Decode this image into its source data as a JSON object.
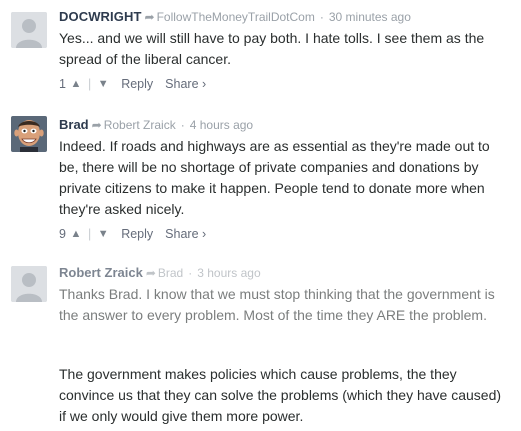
{
  "comments": [
    {
      "author": "DOCWRIGHT",
      "reply_to": "FollowTheMoneyTrailDotCom",
      "time": "30 minutes ago",
      "paragraphs": [
        "Yes... and we will still have to pay both. I hate tolls. I see them as the spread of the liberal cancer."
      ],
      "votes": "1",
      "reply_label": "Reply",
      "share_label": "Share ›",
      "avatar": "default-avatar"
    },
    {
      "author": "Brad",
      "reply_to": "Robert Zraick",
      "time": "4 hours ago",
      "paragraphs": [
        "Indeed. If roads and highways are as essential as they're made out to be, there will be no shortage of private companies and donations by private citizens to make it happen. People tend to donate more when they're asked nicely."
      ],
      "votes": "9",
      "reply_label": "Reply",
      "share_label": "Share ›",
      "avatar": "caricature-photo"
    },
    {
      "author": "Robert Zraick",
      "reply_to": "Brad",
      "time": "3 hours ago",
      "paragraphs": [
        "Thanks Brad. I know that we must stop thinking that the government is the answer to every problem. Most of the time they ARE the problem.",
        "The government makes policies which cause problems, the they convince us that they can solve the problems (which they have caused) if we only would give them more power."
      ],
      "avatar": "default-avatar"
    }
  ],
  "icons": {
    "reply_arrow": "reply-arrow-icon",
    "upvote": "upvote-icon",
    "downvote": "downvote-icon"
  },
  "colors": {
    "author": "#2e3b4e",
    "meta": "#9aa1a8",
    "text": "#2a2e2e",
    "action": "#656c7a"
  }
}
